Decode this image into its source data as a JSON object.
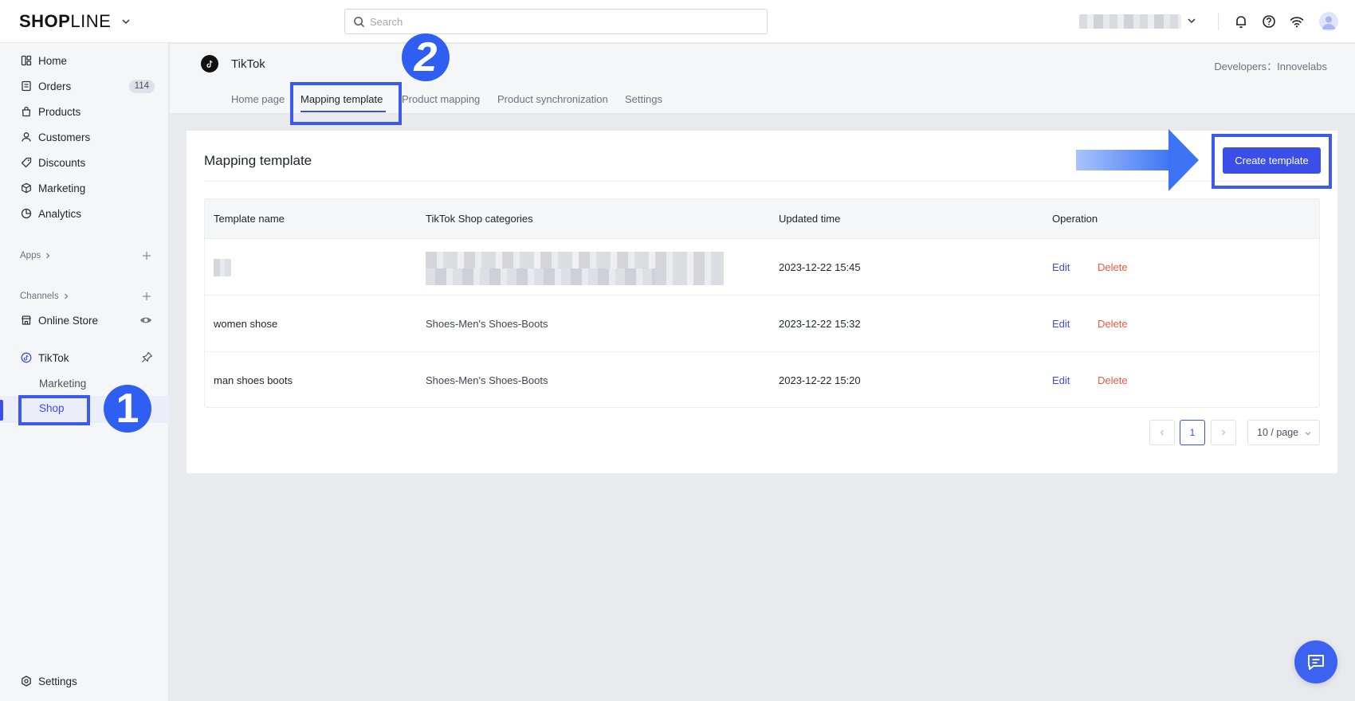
{
  "app": {
    "logo_bold": "SHOP",
    "logo_light": "LINE",
    "search_placeholder": "Search"
  },
  "sidebar": {
    "items": [
      {
        "label": "Home"
      },
      {
        "label": "Orders",
        "badge": "114"
      },
      {
        "label": "Products"
      },
      {
        "label": "Customers"
      },
      {
        "label": "Discounts"
      },
      {
        "label": "Marketing"
      },
      {
        "label": "Analytics"
      }
    ],
    "apps_label": "Apps",
    "channels_label": "Channels",
    "online_store": "Online Store",
    "tiktok": "TikTok",
    "tiktok_sub": {
      "marketing": "Marketing",
      "shop": "Shop"
    },
    "settings": "Settings"
  },
  "annotations": {
    "step1": "1",
    "step2": "2"
  },
  "header": {
    "title": "TikTok",
    "developer": "Developers：Innovelabs",
    "tabs": [
      "Home page",
      "Mapping template",
      "Product mapping",
      "Product synchronization",
      "Settings"
    ],
    "active_tab": "Mapping template"
  },
  "main": {
    "title": "Mapping template",
    "create_button": "Create template",
    "columns": [
      "Template name",
      "TikTok Shop categories",
      "Updated time",
      "Operation"
    ],
    "rows": [
      {
        "name": "",
        "category": "",
        "updated": "2023-12-22 15:45",
        "edit": "Edit",
        "delete": "Delete"
      },
      {
        "name": "women shose",
        "category": "Shoes-Men's Shoes-Boots",
        "updated": "2023-12-22 15:32",
        "edit": "Edit",
        "delete": "Delete"
      },
      {
        "name": "man shoes boots",
        "category": "Shoes-Men's Shoes-Boots",
        "updated": "2023-12-22 15:20",
        "edit": "Edit",
        "delete": "Delete"
      }
    ],
    "pagination": {
      "prev": "<",
      "current": "1",
      "next": ">",
      "page_size": "10 / page"
    }
  },
  "colors": {
    "accent": "#3b4ee8",
    "delete": "#f0593f",
    "annotation": "#2f5ef2"
  }
}
